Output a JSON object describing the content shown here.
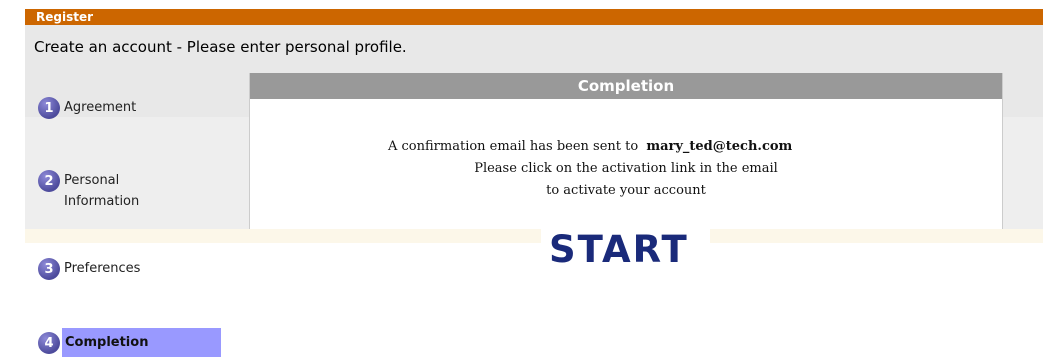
{
  "header": {
    "title": "Register"
  },
  "subtitle": "Create an account - Please enter personal profile.",
  "steps": [
    {
      "number": "1",
      "label": "Agreement"
    },
    {
      "number": "2",
      "label": "Personal",
      "label2": "Information"
    },
    {
      "number": "3",
      "label": "Preferences"
    },
    {
      "number": "4",
      "label": "Completion",
      "active": true
    }
  ],
  "panel": {
    "title": "Completion",
    "message_prefix": "A confirmation email has been sent to",
    "email": "mary_ted@tech.com",
    "message_line2": "Please click on the activation link in the email",
    "message_line3": "to activate your account"
  },
  "start_button": {
    "label": "START"
  },
  "colors": {
    "header": "#cc6600",
    "active_step": "#9999ff",
    "step_circle": "#5856a8",
    "panel_header": "#999999"
  }
}
